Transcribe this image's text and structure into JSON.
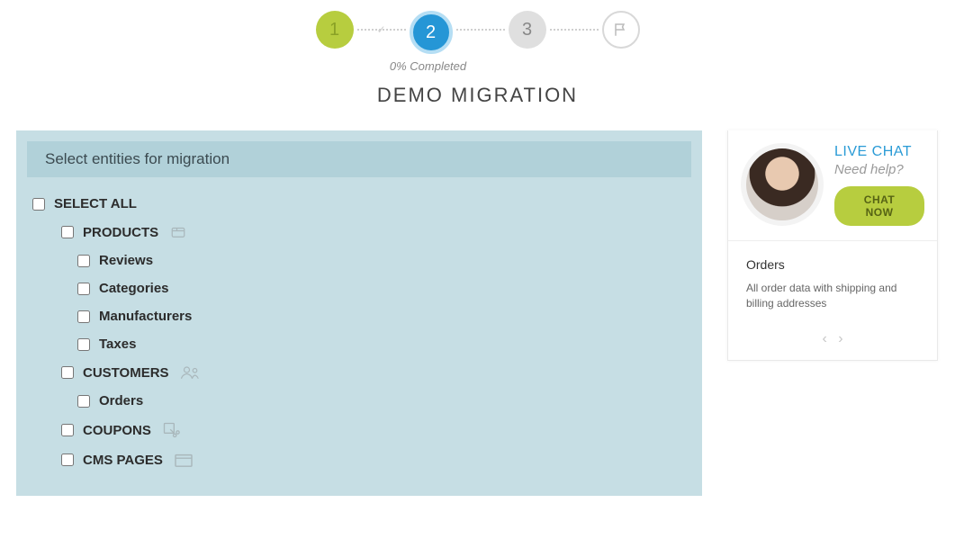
{
  "stepper": {
    "steps": [
      "1",
      "2",
      "3"
    ],
    "active_index": 1,
    "completed_text": "0% Completed"
  },
  "page_title": "DEMO MIGRATION",
  "panel": {
    "header": "Select entities for migration",
    "select_all": "SELECT ALL",
    "groups": [
      {
        "key": "products",
        "label": "PRODUCTS",
        "icon": "box-icon",
        "children": [
          {
            "key": "reviews",
            "label": "Reviews"
          },
          {
            "key": "categories",
            "label": "Categories"
          },
          {
            "key": "manufacturers",
            "label": "Manufacturers"
          },
          {
            "key": "taxes",
            "label": "Taxes"
          }
        ]
      },
      {
        "key": "customers",
        "label": "CUSTOMERS",
        "icon": "people-icon",
        "children": [
          {
            "key": "orders",
            "label": "Orders"
          }
        ]
      },
      {
        "key": "coupons",
        "label": "COUPONS",
        "icon": "scissors-icon",
        "children": []
      },
      {
        "key": "cms",
        "label": "CMS PAGES",
        "icon": "folder-icon",
        "children": []
      }
    ]
  },
  "chat": {
    "title": "LIVE CHAT",
    "subtitle": "Need help?",
    "button": "CHAT NOW"
  },
  "info": {
    "title": "Orders",
    "desc": "All order data with shipping and billing addresses"
  }
}
